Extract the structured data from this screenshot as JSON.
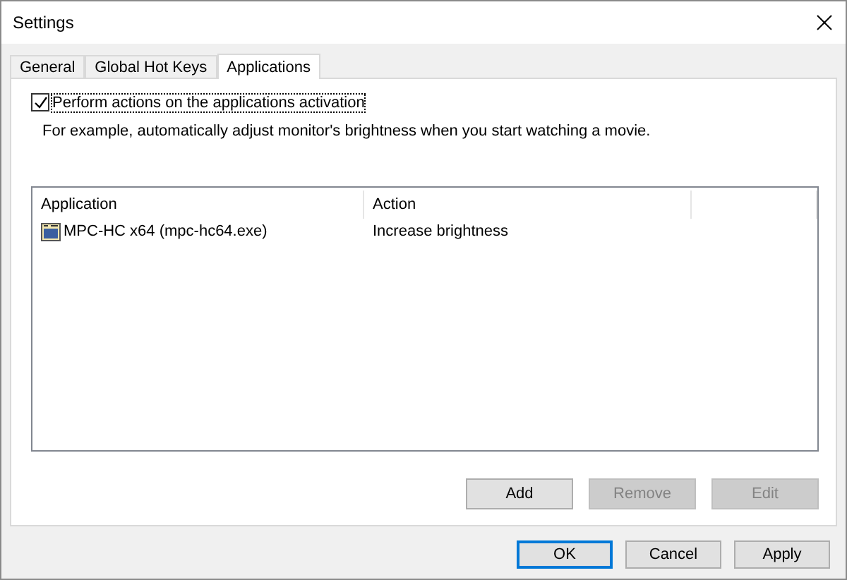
{
  "window": {
    "title": "Settings"
  },
  "tabs": [
    {
      "label": "General",
      "selected": false
    },
    {
      "label": "Global Hot Keys",
      "selected": false
    },
    {
      "label": "Applications",
      "selected": true
    }
  ],
  "option": {
    "label": "Perform actions on the applications activation",
    "checked": true
  },
  "description": "For example, automatically adjust monitor's brightness when you start watching a movie.",
  "table": {
    "columns": [
      "Application",
      "Action"
    ],
    "rows": [
      {
        "application": "MPC-HC x64 (mpc-hc64.exe)",
        "action": "Increase brightness",
        "selected": false
      }
    ]
  },
  "list_buttons": [
    {
      "label": "Add",
      "disabled": false
    },
    {
      "label": "Remove",
      "disabled": true
    },
    {
      "label": "Edit",
      "disabled": true
    }
  ],
  "dialog_buttons": [
    {
      "label": "OK",
      "default": true
    },
    {
      "label": "Cancel",
      "default": false
    },
    {
      "label": "Apply",
      "default": false
    }
  ]
}
